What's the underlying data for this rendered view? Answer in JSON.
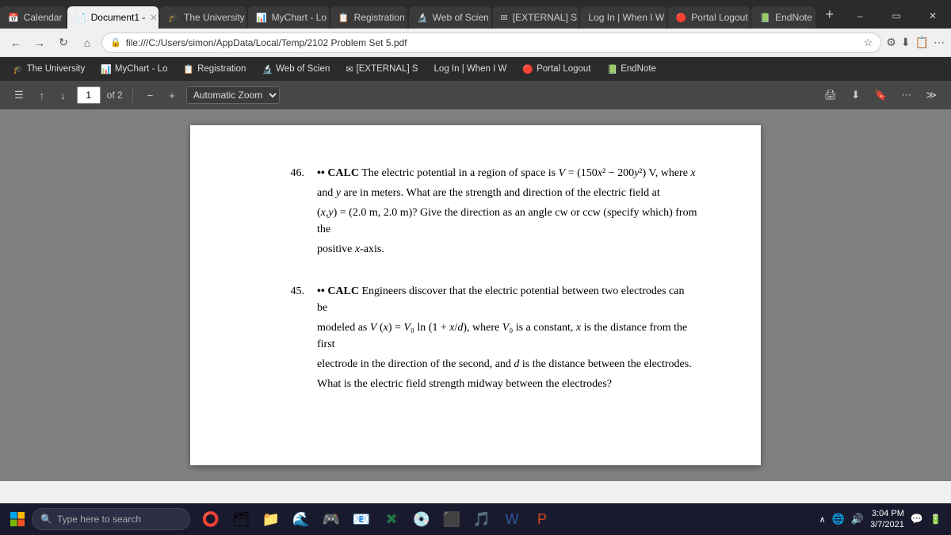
{
  "tabs": [
    {
      "id": "calendar",
      "label": "Calendar",
      "icon": "📅",
      "active": false
    },
    {
      "id": "document1",
      "label": "Document1 -",
      "icon": "📄",
      "active": true,
      "closable": true
    },
    {
      "id": "university",
      "label": "The University",
      "icon": "🎓",
      "active": false
    },
    {
      "id": "mychart",
      "label": "MyChart - Lo",
      "icon": "📊",
      "active": false
    },
    {
      "id": "registration",
      "label": "Registration",
      "icon": "📋",
      "active": false
    },
    {
      "id": "webofscience",
      "label": "Web of Scien",
      "icon": "🔬",
      "active": false
    },
    {
      "id": "external",
      "label": "[EXTERNAL] S",
      "icon": "✉",
      "active": false
    },
    {
      "id": "login",
      "label": "Log In | When I W",
      "icon": "",
      "active": false
    },
    {
      "id": "portallogout",
      "label": "Portal Logout",
      "icon": "🔴",
      "active": false
    },
    {
      "id": "endnote",
      "label": "EndNote",
      "icon": "📗",
      "active": false
    }
  ],
  "address_bar": {
    "url": "file:///C:/Users/simon/AppData/Local/Temp/2102 Problem Set 5.pdf",
    "lock": "🔒"
  },
  "pdf_toolbar": {
    "page_current": "1",
    "page_total": "of 2",
    "zoom_label": "Automatic Zoom"
  },
  "problems": [
    {
      "number": "46.",
      "dots": "••",
      "keyword": "CALC",
      "text": " The electric potential in a region of space is V = (150x² − 200y²) V, where x and y are in meters. What are the strength and direction of the electric field at (x,y) = (2.0 m, 2.0 m)? Give the direction as an angle cw or ccw (specify which) from the positive x-axis."
    },
    {
      "number": "45.",
      "dots": "••",
      "keyword": "CALC",
      "text": " Engineers discover that the electric potential between two electrodes can be modeled as V (x) = V₀ ln (1 + x/d), where V₀ is a constant, x is the distance from the first electrode in the direction of the second, and d is the distance between the electrodes. What is the electric field strength midway between the electrodes?"
    }
  ],
  "bookmarks": [
    {
      "label": "The University",
      "icon": "🎓"
    },
    {
      "label": "MyChart - Lo",
      "icon": "📊"
    },
    {
      "label": "Registration",
      "icon": "📋"
    },
    {
      "label": "Web of Scien",
      "icon": "🔬"
    },
    {
      "label": "[EXTERNAL] S",
      "icon": "✉"
    },
    {
      "label": "Log In | When I W",
      "icon": ""
    },
    {
      "label": "Portal Logout",
      "icon": "🔴"
    },
    {
      "label": "EndNote",
      "icon": "📗"
    }
  ],
  "taskbar": {
    "search_placeholder": "Type here to search",
    "time": "3:04 PM",
    "date": "3/7/2021"
  }
}
